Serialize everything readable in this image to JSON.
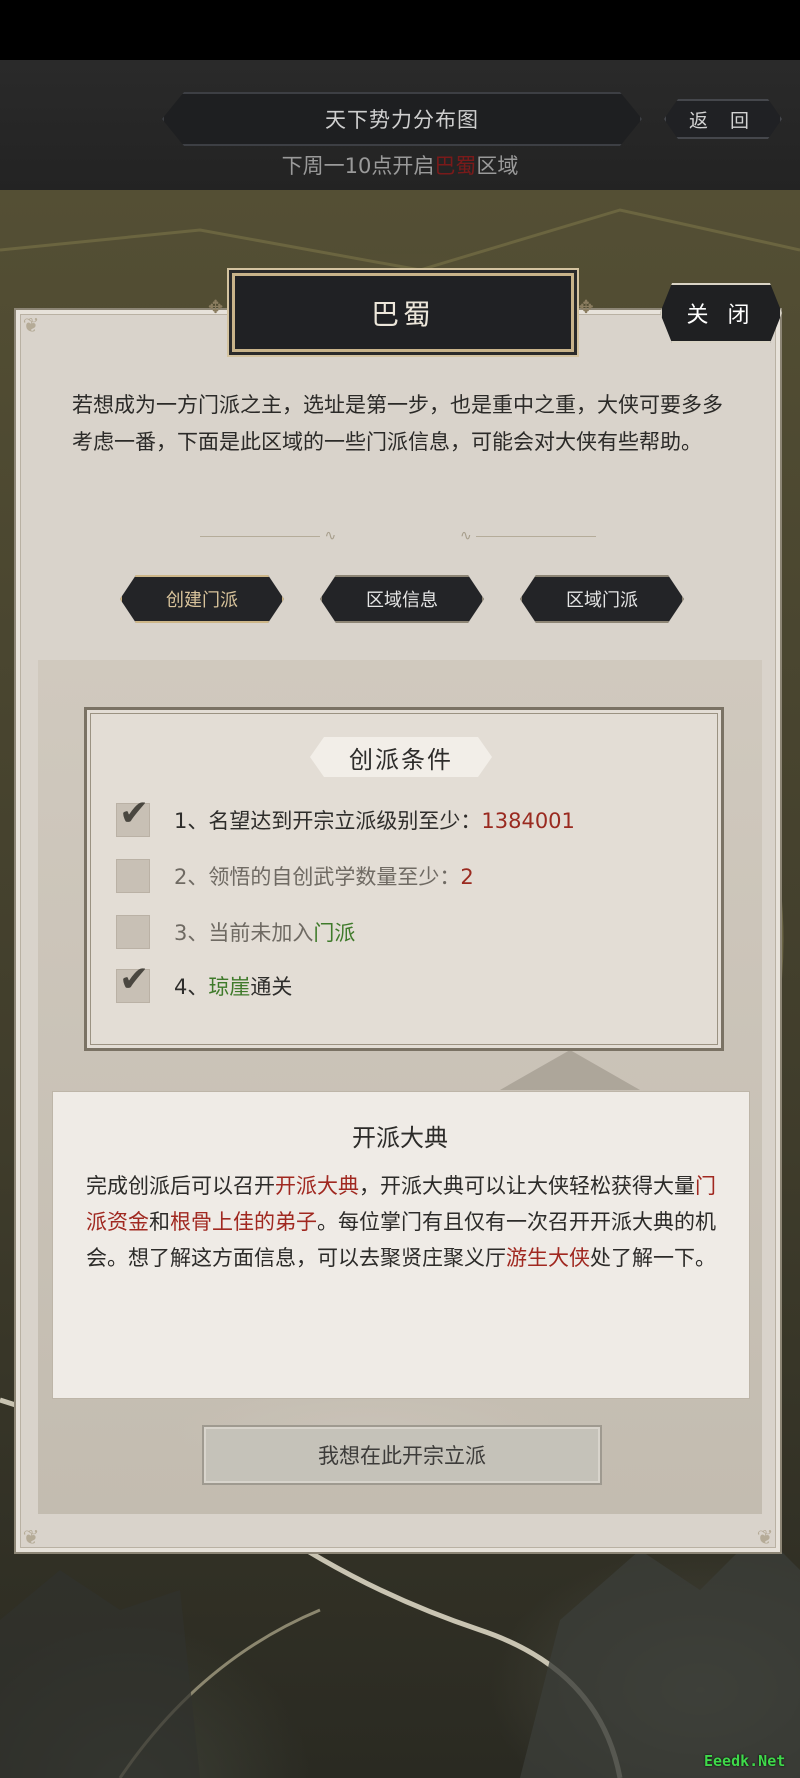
{
  "header": {
    "title": "天下势力分布图",
    "back_label": "返 回",
    "notice_prefix": "下周一10点开启",
    "notice_region": "巴蜀",
    "notice_suffix": "区域"
  },
  "panel": {
    "region_name": "巴蜀",
    "close_label": "关 闭",
    "intro": "若想成为一方门派之主，选址是第一步，也是重中之重，大侠可要多多考虑一番，下面是此区域的一些门派信息，可能会对大侠有些帮助。",
    "tabs": [
      {
        "label": "创建门派",
        "active": true
      },
      {
        "label": "区域信息",
        "active": false
      },
      {
        "label": "区域门派",
        "active": false
      }
    ]
  },
  "conditions": {
    "title": "创派条件",
    "items": [
      {
        "prefix": "1、名望达到开宗立派级别至少：",
        "value": "1384001",
        "suffix": "",
        "checked": true
      },
      {
        "prefix": "2、领悟的自创武学数量至少：",
        "value": "2",
        "suffix": "",
        "checked": false
      },
      {
        "prefix": "3、当前未加入",
        "value": "门派",
        "suffix": "",
        "checked": false
      },
      {
        "prefix": "4、",
        "value": "琼崖",
        "suffix": "通关",
        "checked": true
      }
    ]
  },
  "ceremony": {
    "title": "开派大典",
    "t1": "完成创派后可以召开",
    "h1": "开派大典",
    "t2": "，开派大典可以让大侠轻松获得大量",
    "h2": "门派资金",
    "t3": "和",
    "h3": "根骨上佳的弟子",
    "t4": "。每位掌门有且仅有一次召开开派大典的机会。想了解这方面信息，可以去聚贤庄聚义厅",
    "h4": "游生大侠",
    "t5": "处了解一下。"
  },
  "found_button": "我想在此开宗立派",
  "watermark": "Eeedk.Net",
  "colors": {
    "panel_bg": "#d9d3cb",
    "dark_button": "#202124",
    "gold_border": "#c8b38a",
    "highlight_red": "#9a2a20",
    "highlight_green": "#3f7a2a"
  }
}
